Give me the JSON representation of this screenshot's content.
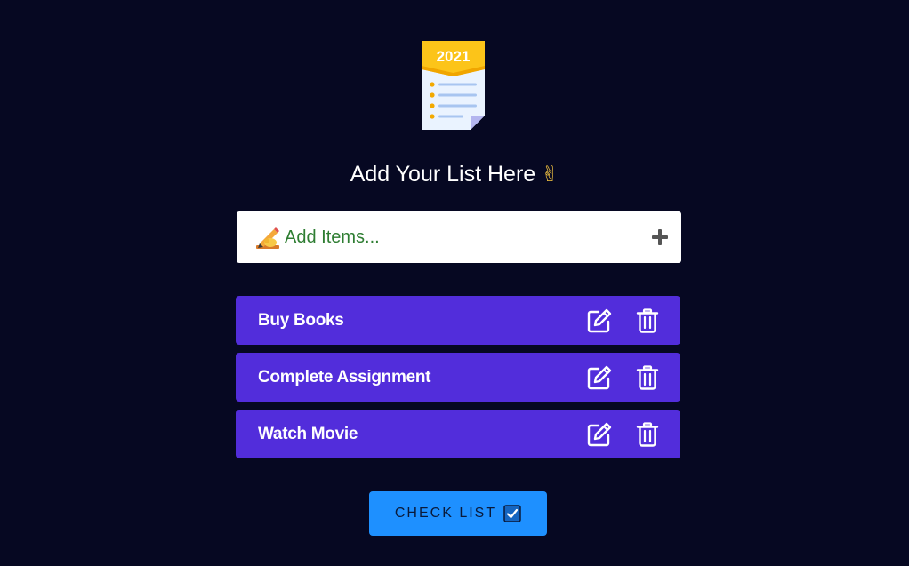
{
  "app": {
    "logo_year": "2021",
    "heading": "Add Your List Here",
    "heading_emoji": "✌"
  },
  "input": {
    "placeholder": "Add Items...",
    "value": "",
    "icon": "writing-hand-icon",
    "add_icon": "plus-icon"
  },
  "items": [
    {
      "label": "Buy Books"
    },
    {
      "label": "Complete Assignment"
    },
    {
      "label": "Watch Movie"
    }
  ],
  "check_button": {
    "label": "CHECK LIST",
    "icon": "checkbox-icon"
  },
  "colors": {
    "background": "#060822",
    "item_bg": "#522ddb",
    "button_bg": "#1e90ff",
    "input_text": "#2e7d32",
    "logo_banner": "#fcc419"
  }
}
